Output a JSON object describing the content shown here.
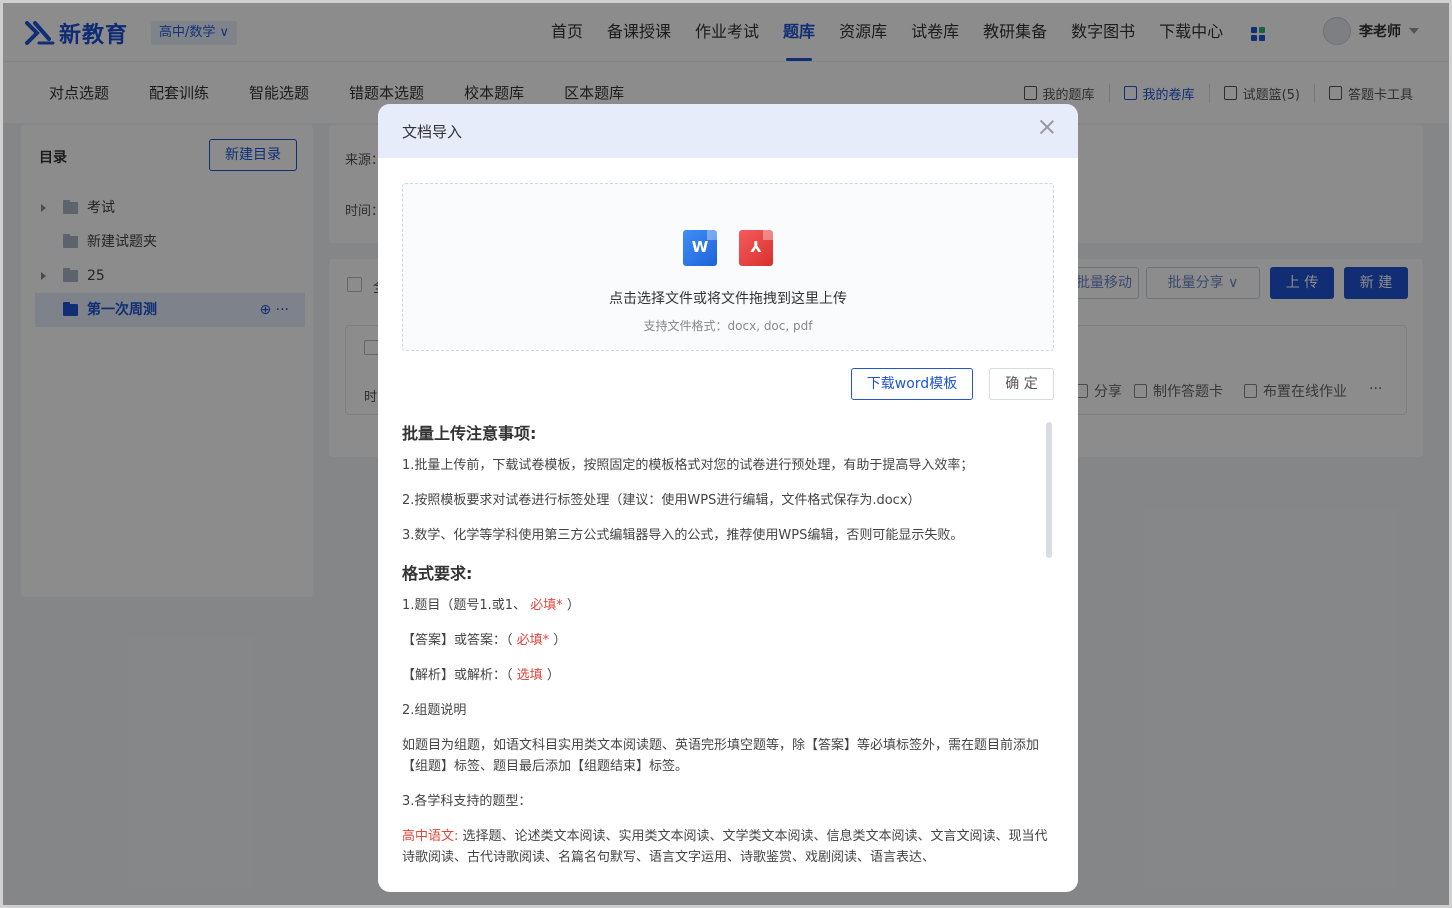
{
  "brand": {
    "name": "新教育",
    "color": "#1f55d4"
  },
  "grade_select": {
    "label": "高中/数学 ∨"
  },
  "nav": {
    "items": [
      "首页",
      "备课授课",
      "作业考试",
      "题库",
      "资源库",
      "试卷库",
      "教研集备",
      "数字图书",
      "下载中心"
    ],
    "active": "题库"
  },
  "user": {
    "name": "李老师"
  },
  "subnav": {
    "tabs": [
      "对点选题",
      "配套训练",
      "智能选题",
      "错题本选题",
      "校本题库",
      "区本题库"
    ],
    "tools": [
      "我的题库",
      "我的卷库",
      "试题篮(5)",
      "答题卡工具"
    ]
  },
  "sidebar": {
    "title": "目录",
    "new_button": "新建目录",
    "items": [
      {
        "label": "考试"
      },
      {
        "label": "新建试题夹"
      },
      {
        "label": "25"
      },
      {
        "label": "第一次周测",
        "actions": "⊕ ···"
      }
    ]
  },
  "main": {
    "source_label": "来源：",
    "time_label": "时间：",
    "select_all": "全",
    "batch_move": "批量移动",
    "batch_share": "批量分享 ∨",
    "upload": "上 传",
    "new": "新 建",
    "card_time": "时",
    "card_actions": [
      "分享",
      "制作答题卡",
      "布置在线作业",
      "···"
    ]
  },
  "modal": {
    "title": "文档导入",
    "dropzone_main": "点击选择文件或将文件拖拽到这里上传",
    "dropzone_sub": "支持文件格式：docx, doc, pdf",
    "word_icon": "W",
    "pdf_icon": "⅄",
    "download_template": "下载word模板",
    "confirm": "确 定",
    "notes_heading": "批量上传注意事项:",
    "notes": [
      "1.批量上传前，下载试卷模板，按照固定的模板格式对您的试卷进行预处理，有助于提高导入效率；",
      "2.按照模板要求对试卷进行标签处理（建议：使用WPS进行编辑，文件格式保存为.docx）",
      "3.数学、化学等学科使用第三方公式编辑器导入的公式，推荐使用WPS编辑，否则可能显示失败。"
    ],
    "format_heading": "格式要求:",
    "format": {
      "q_prefix": "1.题目（题号1.或1、",
      "q_req": "必填*",
      "q_suffix": "）",
      "ans_prefix": "【答案】或答案：（",
      "ans_req": "必填*",
      "ans_suffix": "）",
      "ana_prefix": "【解析】或解析：（",
      "ana_opt": "选填",
      "ana_suffix": "）",
      "group_title": "2.组题说明",
      "group_desc": "如题目为组题，如语文科目实用类文本阅读题、英语完形填空题等，除【答案】等必填标签外，需在题目前添加【组题】标签、题目最后添加【组题结束】标签。",
      "types_title": "3.各学科支持的题型：",
      "chinese_label": "高中语文:",
      "chinese_types": "选择题、论述类文本阅读、实用类文本阅读、文学类文本阅读、信息类文本阅读、文言文阅读、现当代诗歌阅读、古代诗歌阅读、名篇名句默写、语言文字运用、诗歌鉴赏、戏剧阅读、语言表达、"
    }
  }
}
